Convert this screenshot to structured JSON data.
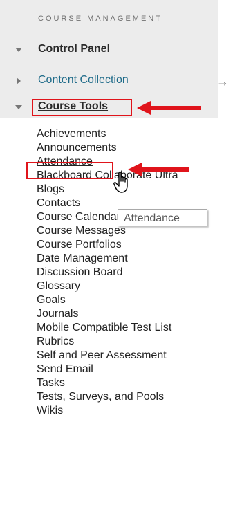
{
  "sidebar": {
    "header": "COURSE MANAGEMENT",
    "control_panel": "Control Panel",
    "content_collection": "Content Collection",
    "content_collection_arrow": "→",
    "course_tools": "Course Tools"
  },
  "course_tools_items": [
    "Achievements",
    "Announcements",
    "Attendance",
    "Blackboard Collaborate Ultra",
    "Blogs",
    "Contacts",
    "Course Calendar",
    "Course Messages",
    "Course Portfolios",
    "Date Management",
    "Discussion Board",
    "Glossary",
    "Goals",
    "Journals",
    "Mobile Compatible Test List",
    "Rubrics",
    "Self and Peer Assessment",
    "Send Email",
    "Tasks",
    "Tests, Surveys, and Pools",
    "Wikis"
  ],
  "tooltip": {
    "text": "Attendance"
  },
  "colors": {
    "highlight_red": "#e0141b",
    "link_teal": "#1f6b89",
    "panel_gray": "#ececec"
  },
  "icons": {
    "expanded": "triangle-down-icon",
    "collapsed": "triangle-right-icon",
    "pointer": "hand-pointer-icon",
    "annotation_arrow": "red-arrow-icon"
  }
}
